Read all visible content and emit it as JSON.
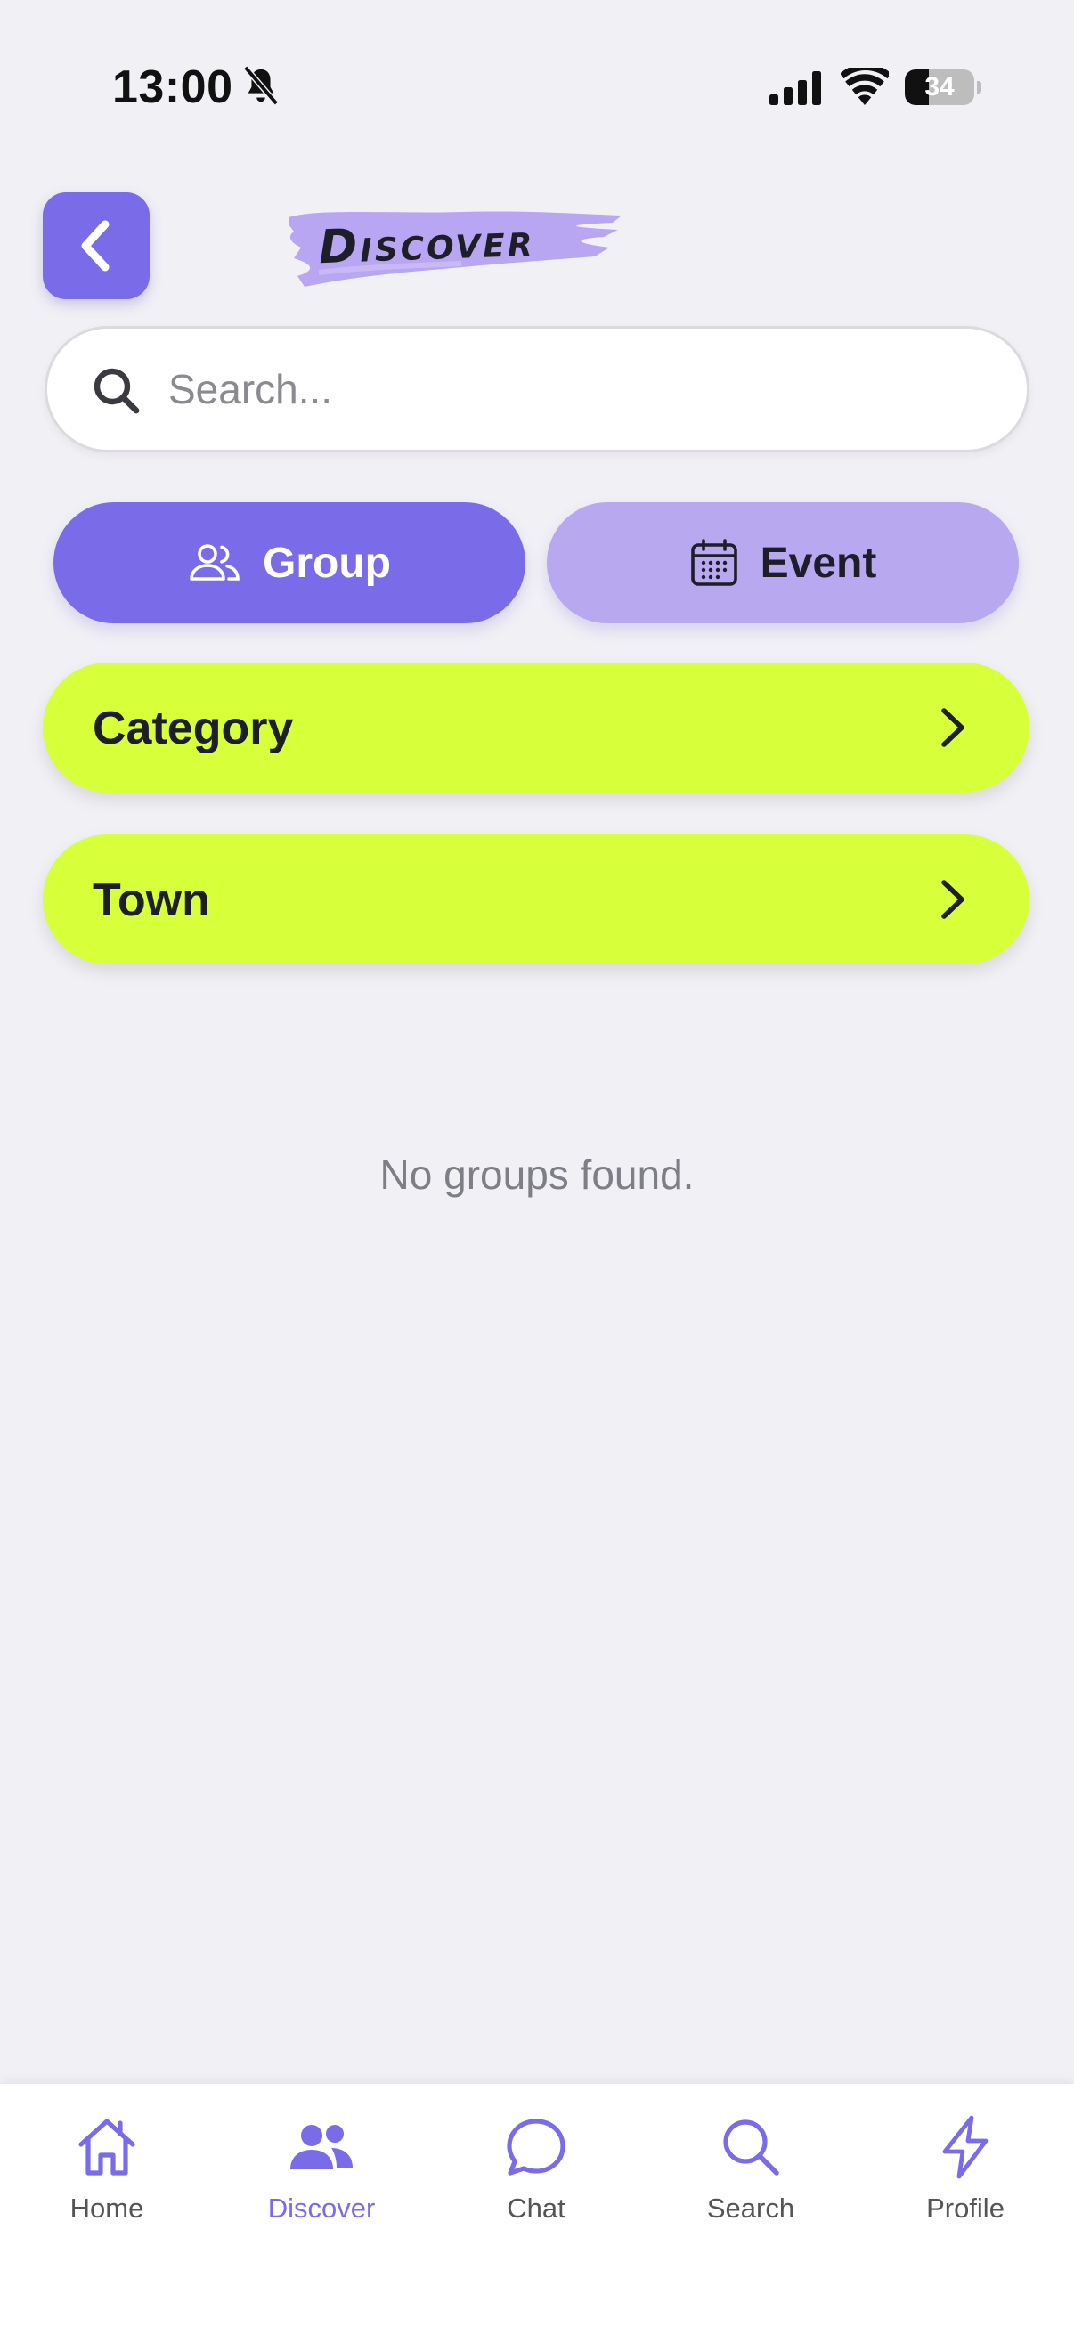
{
  "status_bar": {
    "time": "13:00",
    "battery": "34",
    "battery_level": 0.34
  },
  "header": {
    "title": "Discover"
  },
  "search": {
    "placeholder": "Search..."
  },
  "toggles": {
    "group_label": "Group",
    "event_label": "Event",
    "selected": "Group"
  },
  "filters": {
    "category_label": "Category",
    "town_label": "Town"
  },
  "empty_state": {
    "message": "No groups found."
  },
  "bottom_nav": {
    "items": [
      {
        "label": "Home",
        "icon": "home-icon"
      },
      {
        "label": "Discover",
        "icon": "people-icon",
        "active": true
      },
      {
        "label": "Chat",
        "icon": "chat-bubble-icon"
      },
      {
        "label": "Search",
        "icon": "search-icon"
      },
      {
        "label": "Profile",
        "icon": "lightning-icon"
      }
    ]
  },
  "colors": {
    "accent": "#7A6BE8",
    "accent_light": "#B7A8EF",
    "filter_bg": "#D7FF3A",
    "background": "#F1F0F5"
  }
}
